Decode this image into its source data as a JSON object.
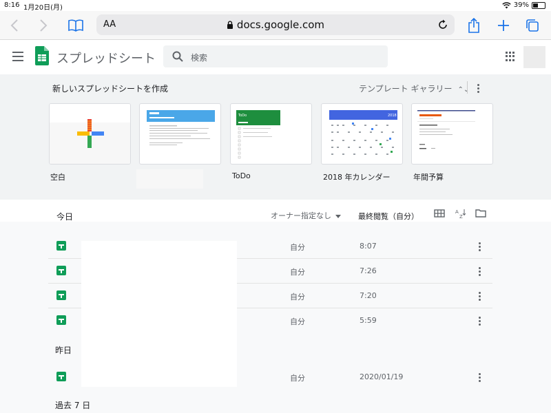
{
  "status_bar": {
    "time": "8:16",
    "date": "1月20日(月)",
    "battery": "39%"
  },
  "browser": {
    "text_size_label": "AA",
    "url": "docs.google.com"
  },
  "app": {
    "title": "スプレッドシート",
    "search_placeholder": "検索"
  },
  "gallery": {
    "title": "新しいスプレッドシートを作成",
    "toggle_label": "テンプレート ギャラリー",
    "templates": [
      {
        "label": "空白"
      },
      {
        "label": ""
      },
      {
        "label": "ToDo",
        "thumb_title": "ToDo"
      },
      {
        "label": "2018 年カレンダー",
        "thumb_title": "2018"
      },
      {
        "label": "年間予算"
      }
    ]
  },
  "files": {
    "sections": {
      "today": "今日",
      "yesterday": "昨日",
      "past_week": "過去 7 日"
    },
    "owner_filter": "オーナー指定なし",
    "sort_label": "最終閲覧（自分）",
    "rows": [
      {
        "owner": "自分",
        "last_opened": "8:07"
      },
      {
        "owner": "自分",
        "last_opened": "7:26"
      },
      {
        "owner": "自分",
        "last_opened": "7:20"
      },
      {
        "owner": "自分",
        "last_opened": "5:59"
      },
      {
        "owner": "自分",
        "last_opened": "2020/01/19"
      }
    ]
  },
  "colors": {
    "accent": "#1a73e8",
    "sheets_green": "#0f9d58",
    "gallery_bg": "#f1f3f4"
  }
}
